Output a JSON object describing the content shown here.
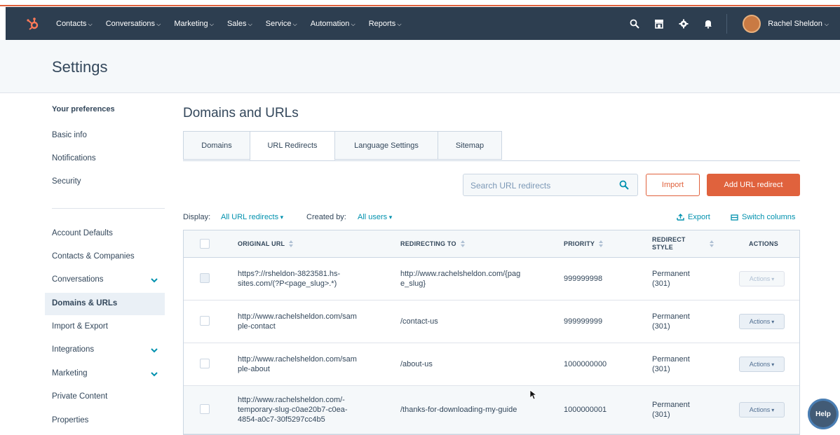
{
  "nav": {
    "menu": [
      "Contacts",
      "Conversations",
      "Marketing",
      "Sales",
      "Service",
      "Automation",
      "Reports"
    ],
    "user_name": "Rachel Sheldon",
    "icons": [
      "search-icon",
      "marketplace-icon",
      "gear-icon",
      "bell-icon"
    ]
  },
  "page": {
    "title": "Settings"
  },
  "sidebar": {
    "section_title": "Your preferences",
    "pref_items": [
      "Basic info",
      "Notifications",
      "Security"
    ],
    "items": [
      {
        "label": "Account Defaults",
        "chevron": false
      },
      {
        "label": "Contacts & Companies",
        "chevron": false
      },
      {
        "label": "Conversations",
        "chevron": true
      },
      {
        "label": "Domains & URLs",
        "chevron": false,
        "active": true
      },
      {
        "label": "Import & Export",
        "chevron": false
      },
      {
        "label": "Integrations",
        "chevron": true
      },
      {
        "label": "Marketing",
        "chevron": true
      },
      {
        "label": "Private Content",
        "chevron": false
      },
      {
        "label": "Properties",
        "chevron": false
      }
    ]
  },
  "main": {
    "heading": "Domains and URLs",
    "tabs": [
      "Domains",
      "URL Redirects",
      "Language Settings",
      "Sitemap"
    ],
    "active_tab": "URL Redirects",
    "search_placeholder": "Search URL redirects",
    "import_label": "Import",
    "add_label": "Add URL redirect",
    "filters": {
      "display_label": "Display:",
      "display_value": "All URL redirects",
      "created_label": "Created by:",
      "created_value": "All users",
      "export_label": "Export",
      "switch_label": "Switch columns"
    },
    "table": {
      "headers": [
        "ORIGINAL URL",
        "REDIRECTING TO",
        "PRIORITY",
        "REDIRECT STYLE",
        "ACTIONS"
      ],
      "header_redirect_style_lines": [
        "REDIRECT",
        "STYLE"
      ],
      "rows": [
        {
          "original": [
            "https?://rsheldon-3823581.hs-",
            "sites.com/(?P<page_slug>.*)"
          ],
          "target": [
            "http://www.rachelsheldon.com/{pag",
            "e_slug}"
          ],
          "priority": "999999998",
          "style": [
            "Permanent",
            "(301)"
          ],
          "actions": "Actions",
          "disabled": true
        },
        {
          "original": [
            "http://www.rachelsheldon.com/sam",
            "ple-contact"
          ],
          "target": [
            "/contact-us"
          ],
          "priority": "999999999",
          "style": [
            "Permanent",
            "(301)"
          ],
          "actions": "Actions",
          "disabled": false
        },
        {
          "original": [
            "http://www.rachelsheldon.com/sam",
            "ple-about"
          ],
          "target": [
            "/about-us"
          ],
          "priority": "1000000000",
          "style": [
            "Permanent",
            "(301)"
          ],
          "actions": "Actions",
          "disabled": false
        },
        {
          "original": [
            "http://www.rachelsheldon.com/-",
            "temporary-slug-c0ae20b7-c0ea-",
            "4854-a0c7-30f5297cc4b5"
          ],
          "target": [
            "/thanks-for-downloading-my-guide"
          ],
          "priority": "1000000001",
          "style": [
            "Permanent",
            "(301)"
          ],
          "actions": "Actions",
          "disabled": false
        }
      ]
    }
  },
  "help_label": "Help",
  "colors": {
    "nav_bg": "#2d3e50",
    "accent": "#e0623d",
    "link": "#0091ae"
  }
}
